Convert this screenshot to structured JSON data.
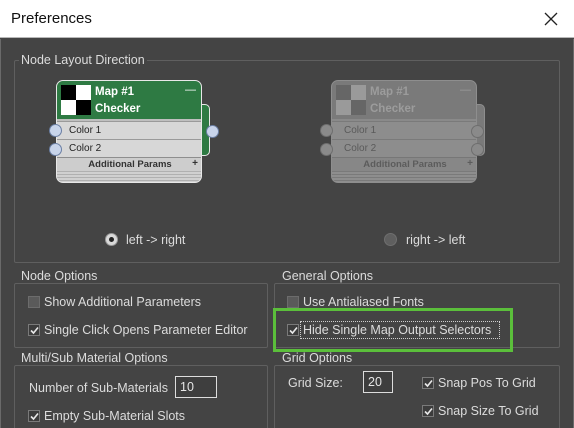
{
  "window": {
    "title": "Preferences"
  },
  "node_layout": {
    "title": "Node Layout Direction",
    "preview": {
      "map_label": "Map #1",
      "map_type": "Checker",
      "collapse_glyph": "—",
      "color1": "Color 1",
      "color2": "Color 2",
      "params_label": "Additional Params",
      "params_expand": "+"
    },
    "left_right": {
      "label": "left -> right",
      "selected": true
    },
    "right_left": {
      "label": "right -> left",
      "selected": false
    }
  },
  "node_options": {
    "title": "Node Options",
    "show_additional": {
      "label": "Show Additional Parameters",
      "checked": false
    },
    "single_click": {
      "label": "Single Click Opens Parameter Editor",
      "checked": true
    }
  },
  "general_options": {
    "title": "General Options",
    "antialiased": {
      "label": "Use Antialiased Fonts",
      "checked": false
    },
    "hide_selectors": {
      "label": "Hide Single Map Output Selectors",
      "checked": true
    }
  },
  "multi_sub": {
    "title": "Multi/Sub Material Options",
    "num_label": "Number of Sub-Materials",
    "num_value": "10",
    "empty_slots": {
      "label": "Empty Sub-Material Slots",
      "checked": true
    }
  },
  "grid_options": {
    "title": "Grid Options",
    "size_label": "Grid Size:",
    "size_value": "20",
    "snap_pos": {
      "label": "Snap Pos To Grid",
      "checked": true
    },
    "snap_size": {
      "label": "Snap Size To Grid",
      "checked": true
    }
  },
  "icons": {
    "close": "close-icon",
    "check": "checkmark-icon",
    "radio": "radio-button",
    "port": "node-port-icon",
    "thumbnail": "checker-thumbnail"
  },
  "colors": {
    "background": "#444444",
    "titlebar": "#ffffff",
    "node_header": "#2e7a43",
    "highlight": "#5bbf3b"
  }
}
